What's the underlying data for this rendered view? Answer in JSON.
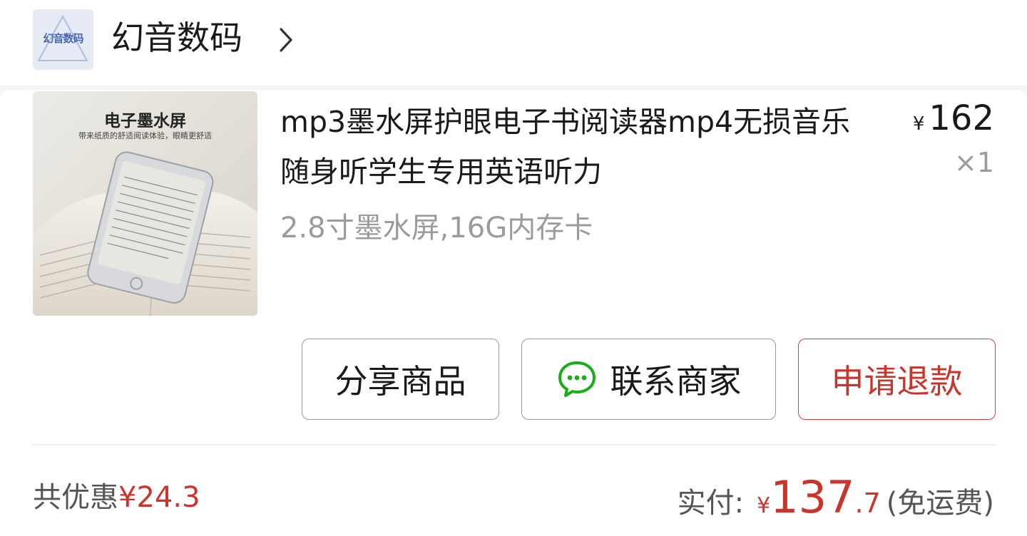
{
  "shop": {
    "logo_text": "幻音数码",
    "name": "幻音数码",
    "chevron_icon": "chevron-right-icon"
  },
  "product": {
    "image": {
      "title": "电子墨水屏",
      "subtitle": "带来纸质的舒适阅读体验，眼睛更舒适"
    },
    "title": "mp3墨水屏护眼电子书阅读器mp4无损音乐随身听学生专用英语听力",
    "spec": "2.8寸墨水屏,16G内存卡",
    "price_symbol": "¥",
    "price": "162",
    "quantity": "×1"
  },
  "actions": {
    "share_label": "分享商品",
    "contact_label": "联系商家",
    "contact_icon": "chat-bubble-icon",
    "refund_label": "申请退款"
  },
  "summary": {
    "discount_label": "共优惠",
    "discount_amount": "¥24.3",
    "paid_label": "实付:",
    "paid_symbol": "¥",
    "paid_integer": "137",
    "paid_decimal": ".7",
    "shipping_note": "(免运费)"
  },
  "colors": {
    "accent_red": "#c9342b",
    "wechat_green": "#1aad19",
    "muted_text": "#9b9b9b"
  }
}
